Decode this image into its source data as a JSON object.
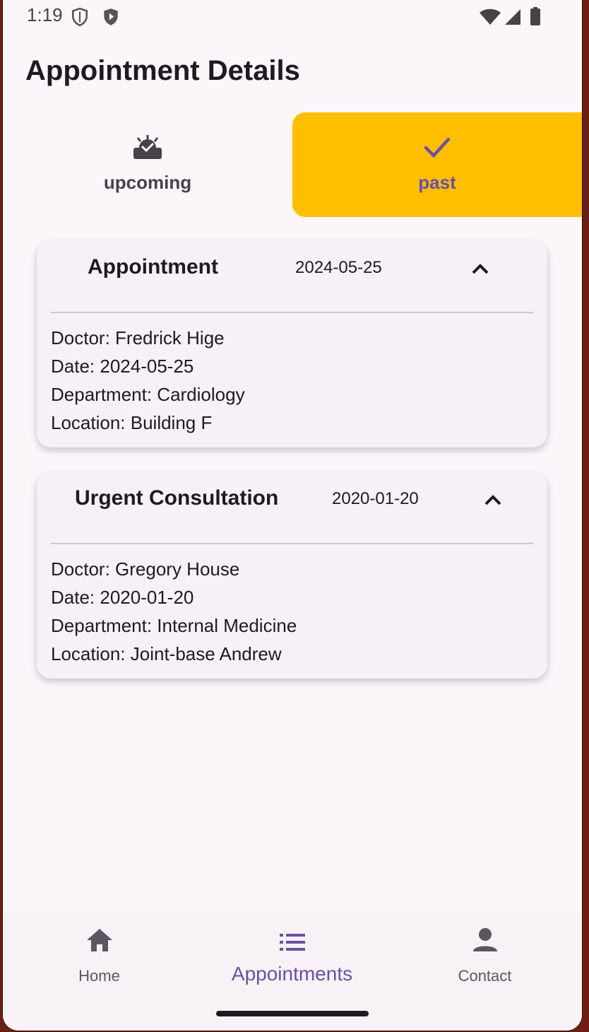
{
  "status_bar": {
    "time": "1:19"
  },
  "header": {
    "title": "Appointment Details"
  },
  "tabs": [
    {
      "label": "upcoming",
      "icon": "alarm-on-icon",
      "selected": false
    },
    {
      "label": "past",
      "icon": "check-icon",
      "selected": true
    }
  ],
  "appointments": [
    {
      "title": "Appointment",
      "date": "2024-05-25",
      "expanded": true,
      "details": [
        "Doctor: Fredrick Hige",
        "Date: 2024-05-25",
        "Department: Cardiology",
        "Location: Building F"
      ]
    },
    {
      "title": "Urgent Consultation",
      "date": "2020-01-20",
      "expanded": true,
      "details": [
        "Doctor: Gregory House",
        "Date: 2020-01-20",
        "Department: Internal Medicine",
        "Location: Joint-base Andrew"
      ]
    }
  ],
  "bottom_nav": [
    {
      "label": "Home",
      "icon": "home-icon",
      "active": false
    },
    {
      "label": "Appointments",
      "icon": "list-icon",
      "active": true
    },
    {
      "label": "Contact",
      "icon": "person-icon",
      "active": false
    }
  ],
  "colors": {
    "accent": "#ffbf00",
    "primary": "#6c4fa3",
    "background": "#fcf6fb",
    "card": "#f6f1f8"
  }
}
